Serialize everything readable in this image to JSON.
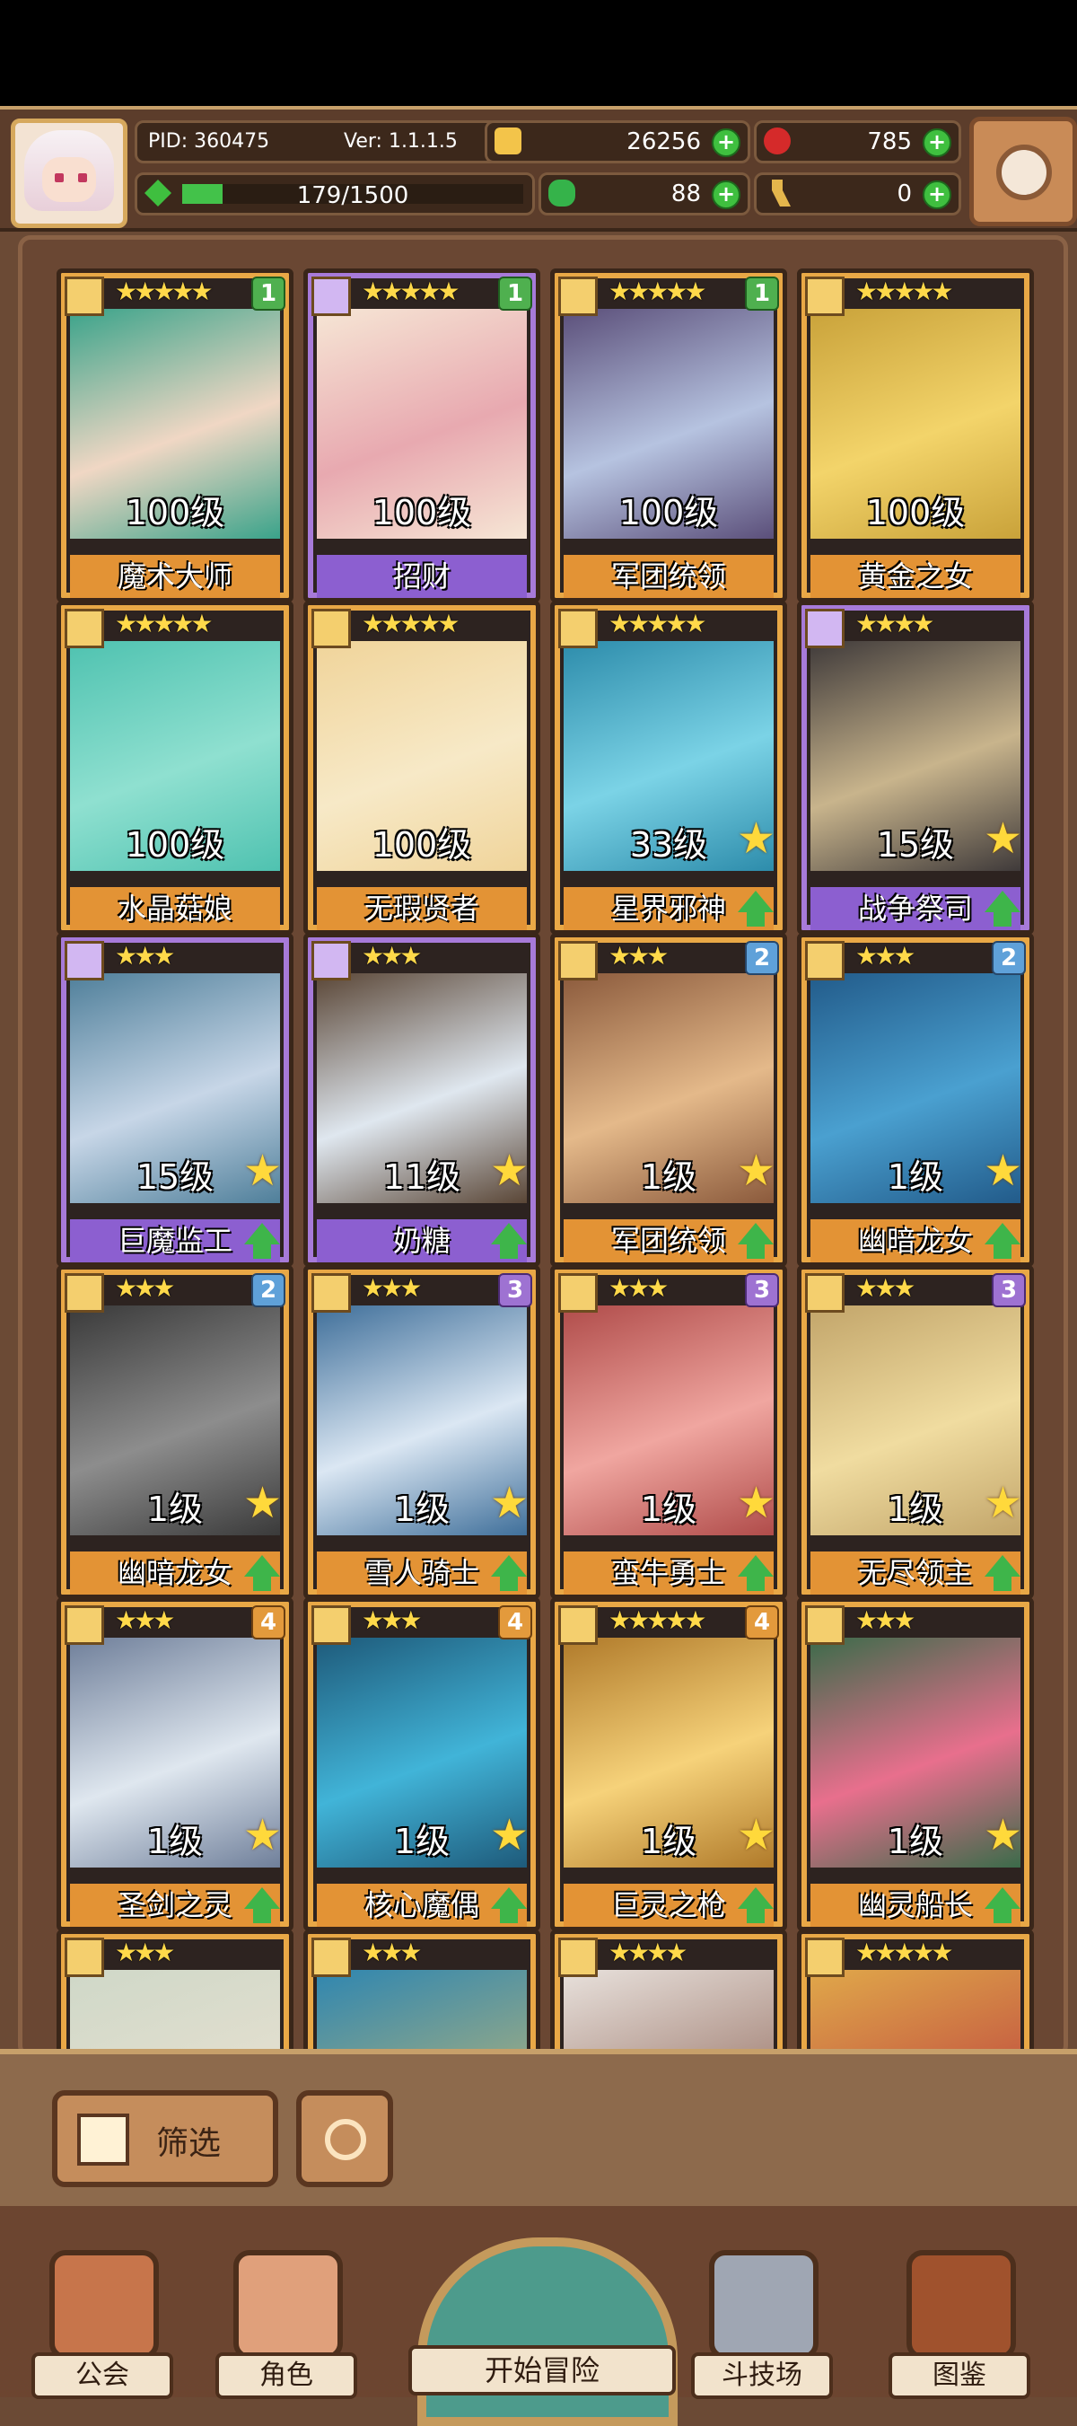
{
  "header": {
    "pid_label": "PID: 360475",
    "version": "Ver: 1.1.1.5",
    "coins": "26256",
    "gems": "785",
    "stamina": "179/1500",
    "stamina_fraction": 0.119,
    "clover": "88",
    "keys": "0"
  },
  "cards": [
    {
      "stars": "★★★★★",
      "badge": "1",
      "badge_color": "green",
      "level": "100级",
      "name": "魔术大师",
      "frame": "gold"
    },
    {
      "stars": "★★★★★",
      "badge": "1",
      "badge_color": "green",
      "level": "100级",
      "name": "招财",
      "frame": "purple"
    },
    {
      "stars": "★★★★★",
      "badge": "1",
      "badge_color": "green",
      "level": "100级",
      "name": "军团统领",
      "frame": "gold"
    },
    {
      "stars": "★★★★★",
      "badge": "",
      "badge_color": "",
      "level": "100级",
      "name": "黄金之女",
      "frame": "gold"
    },
    {
      "stars": "★★★★★",
      "badge": "",
      "badge_color": "",
      "level": "100级",
      "name": "水晶菇娘",
      "frame": "gold"
    },
    {
      "stars": "★★★★★",
      "badge": "",
      "badge_color": "",
      "level": "100级",
      "name": "无瑕贤者",
      "frame": "gold"
    },
    {
      "stars": "★★★★★",
      "badge": "",
      "badge_color": "",
      "level": "33级",
      "name": "星界邪神",
      "frame": "gold",
      "upgrade": true
    },
    {
      "stars": "★★★★",
      "badge": "",
      "badge_color": "",
      "level": "15级",
      "name": "战争祭司",
      "frame": "purple",
      "upgrade": true
    },
    {
      "stars": "★★★",
      "badge": "",
      "badge_color": "",
      "level": "15级",
      "name": "巨魔监工",
      "frame": "purple",
      "upgrade": true
    },
    {
      "stars": "★★★",
      "badge": "",
      "badge_color": "",
      "level": "11级",
      "name": "奶糖",
      "frame": "purple",
      "upgrade": true
    },
    {
      "stars": "★★★",
      "badge": "2",
      "badge_color": "blue",
      "level": "1级",
      "name": "军团统领",
      "frame": "gold",
      "upgrade": true
    },
    {
      "stars": "★★★",
      "badge": "2",
      "badge_color": "blue",
      "level": "1级",
      "name": "幽暗龙女",
      "frame": "gold",
      "upgrade": true
    },
    {
      "stars": "★★★",
      "badge": "2",
      "badge_color": "blue",
      "level": "1级",
      "name": "幽暗龙女",
      "frame": "gold",
      "upgrade": true
    },
    {
      "stars": "★★★",
      "badge": "3",
      "badge_color": "purple",
      "level": "1级",
      "name": "雪人骑士",
      "frame": "gold",
      "upgrade": true
    },
    {
      "stars": "★★★",
      "badge": "3",
      "badge_color": "purple",
      "level": "1级",
      "name": "蛮牛勇士",
      "frame": "gold",
      "upgrade": true
    },
    {
      "stars": "★★★",
      "badge": "3",
      "badge_color": "purple",
      "level": "1级",
      "name": "无尽领主",
      "frame": "gold",
      "upgrade": true
    },
    {
      "stars": "★★★",
      "badge": "4",
      "badge_color": "orange",
      "level": "1级",
      "name": "圣剑之灵",
      "frame": "gold",
      "upgrade": true
    },
    {
      "stars": "★★★",
      "badge": "4",
      "badge_color": "orange",
      "level": "1级",
      "name": "核心魔偶",
      "frame": "gold",
      "upgrade": true
    },
    {
      "stars": "★★★★★",
      "badge": "4",
      "badge_color": "orange",
      "level": "1级",
      "name": "巨灵之枪",
      "frame": "gold",
      "upgrade": true
    },
    {
      "stars": "★★★",
      "badge": "",
      "badge_color": "",
      "level": "1级",
      "name": "幽灵船长",
      "frame": "gold",
      "upgrade": true
    }
  ],
  "partial_row": [
    {
      "stars": "★★★"
    },
    {
      "stars": "★★★"
    },
    {
      "stars": "★★★★"
    },
    {
      "stars": "★★★★★"
    }
  ],
  "filter": {
    "label": "筛选"
  },
  "nav": {
    "guild": "公会",
    "character": "角色",
    "adventure": "开始冒险",
    "arena": "斗技场",
    "codex": "图鉴"
  }
}
